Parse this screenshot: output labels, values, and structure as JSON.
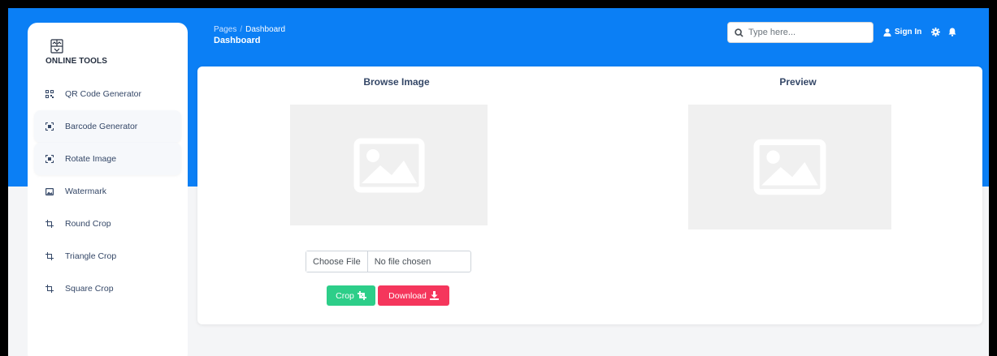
{
  "app": {
    "name": "ONLINE TOOLS"
  },
  "sidebar": {
    "items": [
      {
        "label": "QR Code Generator",
        "icon": "qr-code-icon"
      },
      {
        "label": "Barcode Generator",
        "icon": "scan-icon"
      },
      {
        "label": "Rotate Image",
        "icon": "scan-icon"
      },
      {
        "label": "Watermark",
        "icon": "image-icon"
      },
      {
        "label": "Round Crop",
        "icon": "crop-icon"
      },
      {
        "label": "Triangle Crop",
        "icon": "crop-icon"
      },
      {
        "label": "Square Crop",
        "icon": "crop-icon"
      }
    ]
  },
  "header": {
    "breadcrumb_root": "Pages",
    "breadcrumb_sep": "/",
    "breadcrumb_current": "Dashboard",
    "title": "Dashboard",
    "search_placeholder": "Type here...",
    "signin_label": "Sign In"
  },
  "main": {
    "browse_title": "Browse Image",
    "preview_title": "Preview",
    "choose_file_label": "Choose File",
    "file_status": "No file chosen",
    "crop_label": "Crop",
    "download_label": "Download"
  },
  "colors": {
    "primary": "#0b7ff5",
    "success": "#2dce89",
    "danger": "#f5365c",
    "placeholder_bg": "#f0f0f0"
  }
}
